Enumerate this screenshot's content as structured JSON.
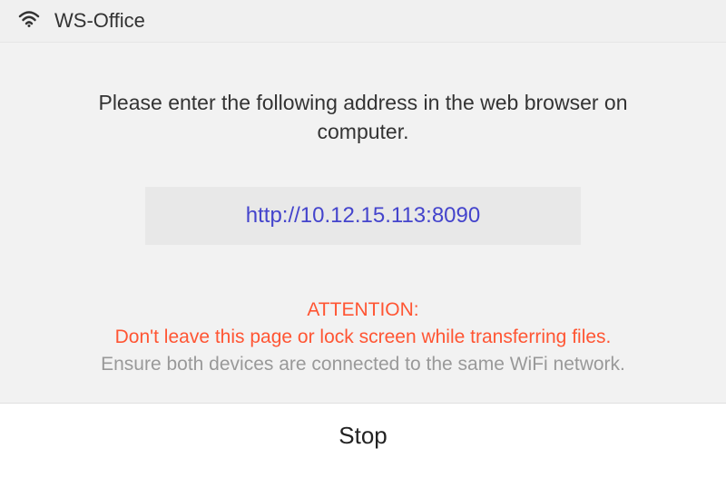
{
  "header": {
    "title": "WS-Office"
  },
  "content": {
    "instruction": "Please enter the following address in the web browser on computer.",
    "url": "http://10.12.15.113:8090",
    "attention_label": "ATTENTION:",
    "attention_warning": "Don't leave this page or lock screen while transferring files.",
    "network_hint": "Ensure both devices are connected to the same WiFi network."
  },
  "footer": {
    "stop_label": "Stop"
  }
}
